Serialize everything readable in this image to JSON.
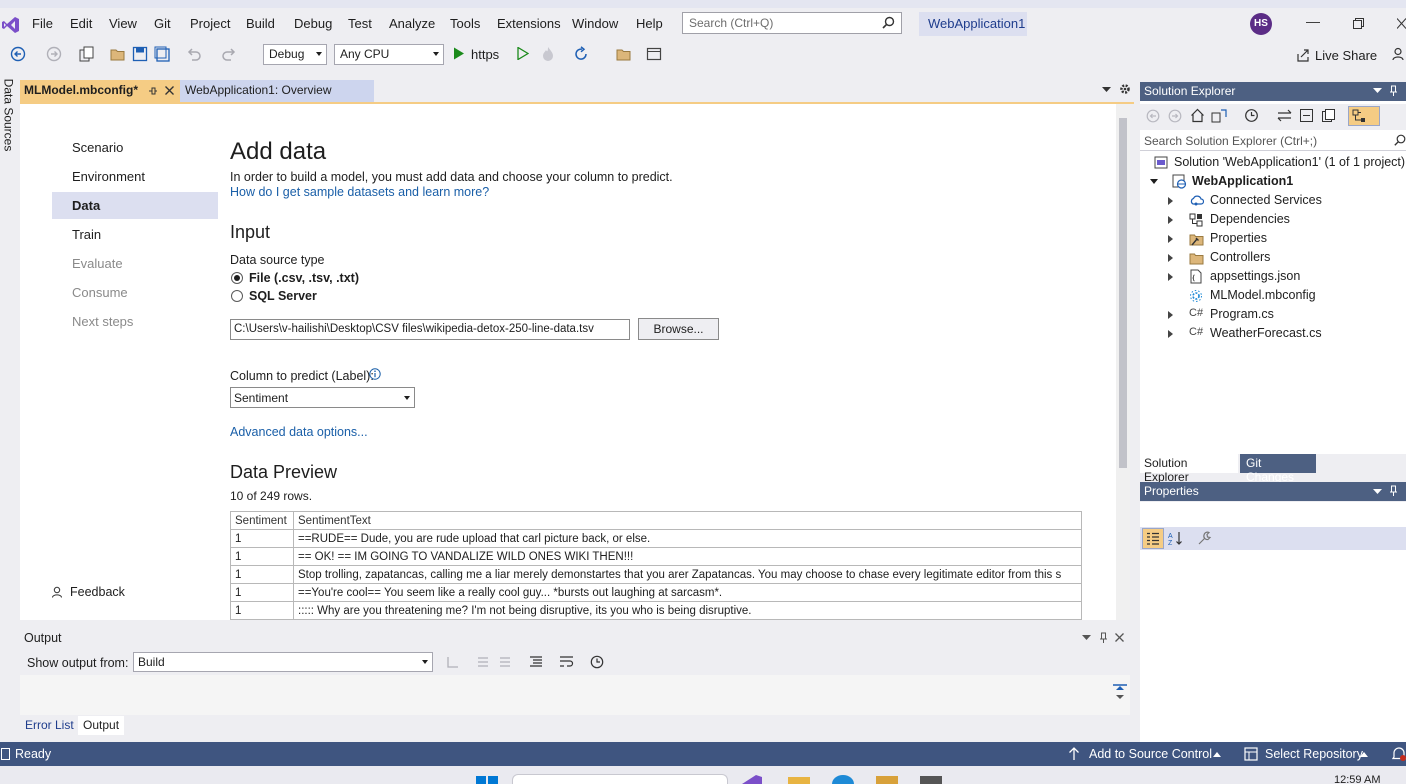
{
  "menu": [
    "File",
    "Edit",
    "View",
    "Git",
    "Project",
    "Build",
    "Debug",
    "Test",
    "Analyze",
    "Tools",
    "Extensions",
    "Window",
    "Help"
  ],
  "search": {
    "placeholder": "Search (Ctrl+Q)"
  },
  "project_name": "WebApplication1",
  "user_initials": "HS",
  "toolbar": {
    "configuration": "Debug",
    "platform": "Any CPU",
    "run_target": "https",
    "live_share": "Live Share"
  },
  "left_strip_label": "Data Sources",
  "doc_tabs": [
    {
      "label": "MLModel.mbconfig*",
      "active": true
    },
    {
      "label": "WebApplication1: Overview",
      "active": false
    }
  ],
  "wizard_nav": [
    {
      "label": "Scenario",
      "state": "normal"
    },
    {
      "label": "Environment",
      "state": "normal"
    },
    {
      "label": "Data",
      "state": "active"
    },
    {
      "label": "Train",
      "state": "normal"
    },
    {
      "label": "Evaluate",
      "state": "disabled"
    },
    {
      "label": "Consume",
      "state": "disabled"
    },
    {
      "label": "Next steps",
      "state": "disabled"
    }
  ],
  "feedback_label": "Feedback",
  "add_data": {
    "title": "Add data",
    "description": "In order to build a model, you must add data and choose your column to predict.",
    "help_link": "How do I get sample datasets and learn more?",
    "input_heading": "Input",
    "data_source_label": "Data source type",
    "source_options": [
      {
        "label": "File (.csv, .tsv, .txt)",
        "selected": true
      },
      {
        "label": "SQL Server",
        "selected": false
      }
    ],
    "file_path": "C:\\Users\\v-hailishi\\Desktop\\CSV files\\wikipedia-detox-250-line-data.tsv",
    "browse_label": "Browse...",
    "column_label": "Column to predict (Label):",
    "column_value": "Sentiment",
    "advanced_link": "Advanced data options...",
    "preview_heading": "Data Preview",
    "preview_count": "10 of 249 rows.",
    "preview_columns": [
      "Sentiment",
      "SentimentText"
    ],
    "preview_rows": [
      [
        "1",
        "==RUDE== Dude, you are rude upload that carl picture back, or else."
      ],
      [
        "1",
        "== OK! ==  IM GOING TO VANDALIZE WILD ONES WIKI THEN!!!"
      ],
      [
        "1",
        "Stop trolling, zapatancas, calling me a liar merely demonstartes that you arer Zapatancas. You may choose to chase every legitimate editor from this s"
      ],
      [
        "1",
        "==You're cool==  You seem like a really cool guy... *bursts out laughing at sarcasm*."
      ],
      [
        "1",
        "::::: Why are you threatening me? I'm not being disruptive, its you who is being disruptive."
      ]
    ]
  },
  "output": {
    "title": "Output",
    "show_from_label": "Show output from:",
    "source": "Build"
  },
  "bottom_tabs": [
    "Error List",
    "Output"
  ],
  "solution_explorer": {
    "title": "Solution Explorer",
    "search_placeholder": "Search Solution Explorer (Ctrl+;)",
    "solution": "Solution 'WebApplication1' (1 of 1 project)",
    "project": "WebApplication1",
    "items": [
      {
        "label": "Connected Services",
        "icon": "connected-services-icon",
        "expandable": true
      },
      {
        "label": "Dependencies",
        "icon": "dependencies-icon",
        "expandable": true
      },
      {
        "label": "Properties",
        "icon": "properties-icon",
        "expandable": true
      },
      {
        "label": "Controllers",
        "icon": "folder-icon",
        "expandable": true
      },
      {
        "label": "appsettings.json",
        "icon": "json-file-icon",
        "expandable": true
      },
      {
        "label": "MLModel.mbconfig",
        "icon": "mlmodel-icon",
        "expandable": false
      },
      {
        "label": "Program.cs",
        "icon": "csharp-file-icon",
        "expandable": true
      },
      {
        "label": "WeatherForecast.cs",
        "icon": "csharp-file-icon",
        "expandable": true
      }
    ],
    "tabs": [
      "Solution Explorer",
      "Git Changes"
    ]
  },
  "properties_title": "Properties",
  "status": {
    "text": "Ready",
    "source_control": "Add to Source Control",
    "repository": "Select Repository"
  },
  "taskbar_time": "12:59 AM",
  "colors": {
    "accent_tab": "#f5cc84",
    "status_bar": "#3f5580",
    "panel_header": "#4d6082",
    "link": "#1a5fa8"
  }
}
